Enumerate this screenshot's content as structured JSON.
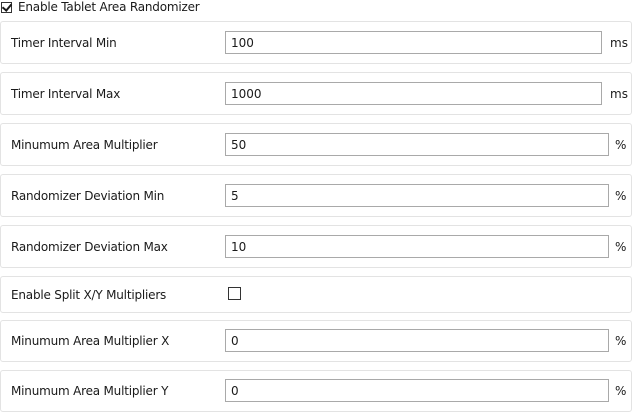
{
  "header": {
    "enable_randomizer_label": "Enable Tablet Area Randomizer",
    "enable_randomizer_checked": true
  },
  "rows": {
    "timer_min": {
      "label": "Timer Interval Min",
      "value": "100",
      "unit": "ms"
    },
    "timer_max": {
      "label": "Timer Interval Max",
      "value": "1000",
      "unit": "ms"
    },
    "min_area_multiplier": {
      "label": "Minumum Area Multiplier",
      "value": "50",
      "unit": "%"
    },
    "deviation_min": {
      "label": "Randomizer Deviation Min",
      "value": "5",
      "unit": "%"
    },
    "deviation_max": {
      "label": "Randomizer Deviation Max",
      "value": "10",
      "unit": "%"
    },
    "split_xy": {
      "label": "Enable Split X/Y Multipliers",
      "checked": false
    },
    "min_area_multiplier_x": {
      "label": "Minumum Area Multiplier X",
      "value": "0",
      "unit": "%"
    },
    "min_area_multiplier_y": {
      "label": "Minumum Area Multiplier Y",
      "value": "0",
      "unit": "%"
    }
  }
}
